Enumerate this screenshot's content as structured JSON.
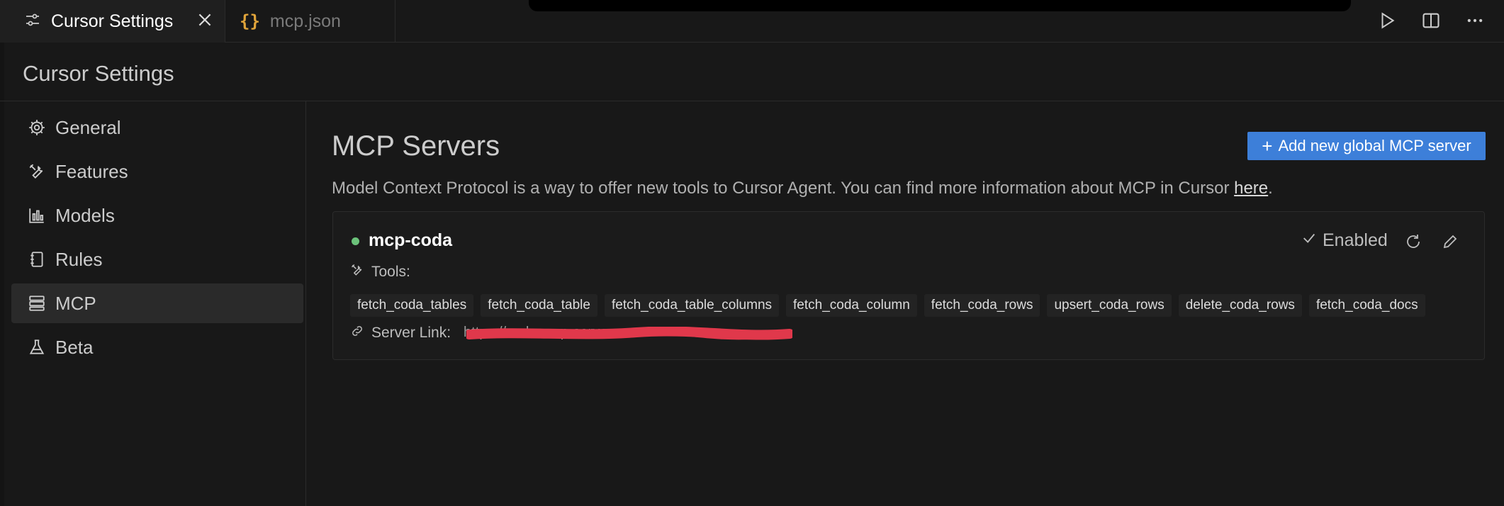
{
  "tabs": [
    {
      "label": "Cursor Settings",
      "active": true,
      "icon": "settings-sliders-icon"
    },
    {
      "label": "mcp.json",
      "active": false,
      "icon": "json-braces-icon"
    }
  ],
  "header": {
    "title": "Cursor Settings"
  },
  "sidebar": {
    "items": [
      {
        "label": "General",
        "icon": "gear-icon"
      },
      {
        "label": "Features",
        "icon": "tools-icon"
      },
      {
        "label": "Models",
        "icon": "bar-chart-icon"
      },
      {
        "label": "Rules",
        "icon": "notebook-icon"
      },
      {
        "label": "MCP",
        "icon": "server-icon",
        "active": true
      },
      {
        "label": "Beta",
        "icon": "flask-icon"
      }
    ]
  },
  "main": {
    "title": "MCP Servers",
    "add_button": "Add new global MCP server",
    "description_prefix": "Model Context Protocol is a way to offer new tools to Cursor Agent. You can find more information about MCP in Cursor ",
    "description_link": "here",
    "description_suffix": ".",
    "server": {
      "name": "mcp-coda",
      "status_color": "#6bc27a",
      "enabled_label": "Enabled",
      "tools_label": "Tools:",
      "tools": [
        "fetch_coda_tables",
        "fetch_coda_table",
        "fetch_coda_table_columns",
        "fetch_coda_column",
        "fetch_coda_rows",
        "upsert_coda_rows",
        "delete_coda_rows",
        "fetch_coda_docs"
      ],
      "server_link_label": "Server Link:",
      "server_link_value": "https://coda-mcp-server..."
    }
  },
  "colors": {
    "accent": "#3d7fd9",
    "redaction": "#e0384b"
  }
}
